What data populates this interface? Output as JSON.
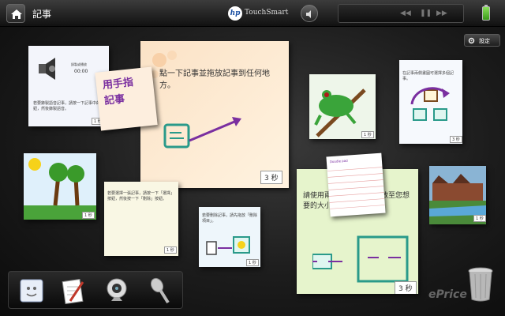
{
  "topbar": {
    "title": "記事",
    "brand": "TouchSmart",
    "hp_logo": "hp",
    "media_controls": [
      "◀◀",
      "❚❚",
      "▶▶"
    ]
  },
  "settings": {
    "label": "設定"
  },
  "notes": {
    "audio": {
      "title": "錄製或播放",
      "time": "00:00",
      "body": "若要錄製語音記事，請按一下記事中的按鈕，然後錄製語音。",
      "duration": "1 秒"
    },
    "handwrite": {
      "text": "用手指\n記事"
    },
    "main": {
      "text": "點一下記事並拖放記事到任何地方。",
      "duration": "3 秒"
    },
    "frog": {
      "duration": "1 秒"
    },
    "rotate": {
      "text": "在記事兩側畫圓可選擇多個記事。",
      "duration": "3 秒"
    },
    "tree": {
      "duration": "1 秒"
    },
    "delete": {
      "body": "若要選擇一張記事，請按一下「選擇」按鈕，然後按一下「刪除」按鈕。",
      "duration": "1 秒"
    },
    "trash_hint": {
      "body": "若要刪除記事，請先拖放「刪除項目」。",
      "duration": "1 秒"
    },
    "lined": {
      "header": "Doodle pad"
    },
    "resize": {
      "text": "請使用兩隻手指將記事縮放至您想要的大小。",
      "duration": "3 秒"
    },
    "house": {
      "duration": "1 秒"
    }
  },
  "dock": {
    "items": [
      {
        "icon": "sticky-note-icon"
      },
      {
        "icon": "paper-pen-icon"
      },
      {
        "icon": "webcam-icon"
      },
      {
        "icon": "microphone-icon"
      }
    ]
  },
  "watermark": "ePrice",
  "colors": {
    "accent": "#7a2fa0",
    "teal": "#2a9a8a",
    "topbar": "#1a1a1a"
  }
}
